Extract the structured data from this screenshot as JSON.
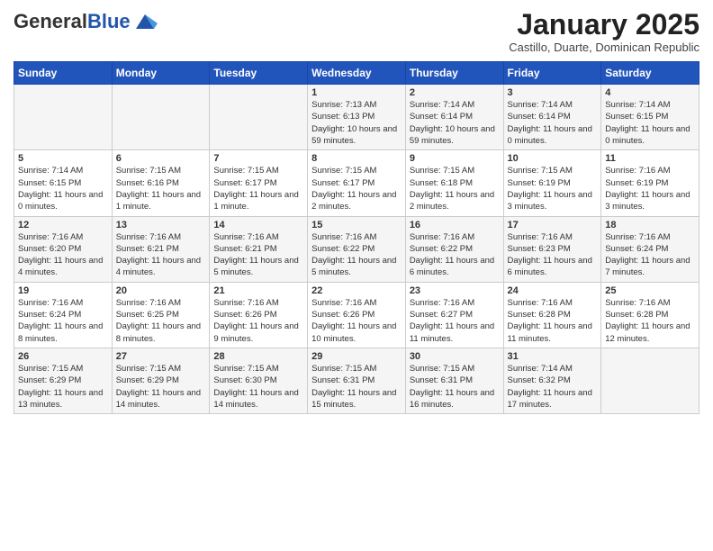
{
  "header": {
    "logo_general": "General",
    "logo_blue": "Blue",
    "month_title": "January 2025",
    "subtitle": "Castillo, Duarte, Dominican Republic"
  },
  "days_of_week": [
    "Sunday",
    "Monday",
    "Tuesday",
    "Wednesday",
    "Thursday",
    "Friday",
    "Saturday"
  ],
  "weeks": [
    [
      {
        "day": "",
        "info": ""
      },
      {
        "day": "",
        "info": ""
      },
      {
        "day": "",
        "info": ""
      },
      {
        "day": "1",
        "info": "Sunrise: 7:13 AM\nSunset: 6:13 PM\nDaylight: 10 hours and 59 minutes."
      },
      {
        "day": "2",
        "info": "Sunrise: 7:14 AM\nSunset: 6:14 PM\nDaylight: 10 hours and 59 minutes."
      },
      {
        "day": "3",
        "info": "Sunrise: 7:14 AM\nSunset: 6:14 PM\nDaylight: 11 hours and 0 minutes."
      },
      {
        "day": "4",
        "info": "Sunrise: 7:14 AM\nSunset: 6:15 PM\nDaylight: 11 hours and 0 minutes."
      }
    ],
    [
      {
        "day": "5",
        "info": "Sunrise: 7:14 AM\nSunset: 6:15 PM\nDaylight: 11 hours and 0 minutes."
      },
      {
        "day": "6",
        "info": "Sunrise: 7:15 AM\nSunset: 6:16 PM\nDaylight: 11 hours and 1 minute."
      },
      {
        "day": "7",
        "info": "Sunrise: 7:15 AM\nSunset: 6:17 PM\nDaylight: 11 hours and 1 minute."
      },
      {
        "day": "8",
        "info": "Sunrise: 7:15 AM\nSunset: 6:17 PM\nDaylight: 11 hours and 2 minutes."
      },
      {
        "day": "9",
        "info": "Sunrise: 7:15 AM\nSunset: 6:18 PM\nDaylight: 11 hours and 2 minutes."
      },
      {
        "day": "10",
        "info": "Sunrise: 7:15 AM\nSunset: 6:19 PM\nDaylight: 11 hours and 3 minutes."
      },
      {
        "day": "11",
        "info": "Sunrise: 7:16 AM\nSunset: 6:19 PM\nDaylight: 11 hours and 3 minutes."
      }
    ],
    [
      {
        "day": "12",
        "info": "Sunrise: 7:16 AM\nSunset: 6:20 PM\nDaylight: 11 hours and 4 minutes."
      },
      {
        "day": "13",
        "info": "Sunrise: 7:16 AM\nSunset: 6:21 PM\nDaylight: 11 hours and 4 minutes."
      },
      {
        "day": "14",
        "info": "Sunrise: 7:16 AM\nSunset: 6:21 PM\nDaylight: 11 hours and 5 minutes."
      },
      {
        "day": "15",
        "info": "Sunrise: 7:16 AM\nSunset: 6:22 PM\nDaylight: 11 hours and 5 minutes."
      },
      {
        "day": "16",
        "info": "Sunrise: 7:16 AM\nSunset: 6:22 PM\nDaylight: 11 hours and 6 minutes."
      },
      {
        "day": "17",
        "info": "Sunrise: 7:16 AM\nSunset: 6:23 PM\nDaylight: 11 hours and 6 minutes."
      },
      {
        "day": "18",
        "info": "Sunrise: 7:16 AM\nSunset: 6:24 PM\nDaylight: 11 hours and 7 minutes."
      }
    ],
    [
      {
        "day": "19",
        "info": "Sunrise: 7:16 AM\nSunset: 6:24 PM\nDaylight: 11 hours and 8 minutes."
      },
      {
        "day": "20",
        "info": "Sunrise: 7:16 AM\nSunset: 6:25 PM\nDaylight: 11 hours and 8 minutes."
      },
      {
        "day": "21",
        "info": "Sunrise: 7:16 AM\nSunset: 6:26 PM\nDaylight: 11 hours and 9 minutes."
      },
      {
        "day": "22",
        "info": "Sunrise: 7:16 AM\nSunset: 6:26 PM\nDaylight: 11 hours and 10 minutes."
      },
      {
        "day": "23",
        "info": "Sunrise: 7:16 AM\nSunset: 6:27 PM\nDaylight: 11 hours and 11 minutes."
      },
      {
        "day": "24",
        "info": "Sunrise: 7:16 AM\nSunset: 6:28 PM\nDaylight: 11 hours and 11 minutes."
      },
      {
        "day": "25",
        "info": "Sunrise: 7:16 AM\nSunset: 6:28 PM\nDaylight: 11 hours and 12 minutes."
      }
    ],
    [
      {
        "day": "26",
        "info": "Sunrise: 7:15 AM\nSunset: 6:29 PM\nDaylight: 11 hours and 13 minutes."
      },
      {
        "day": "27",
        "info": "Sunrise: 7:15 AM\nSunset: 6:29 PM\nDaylight: 11 hours and 14 minutes."
      },
      {
        "day": "28",
        "info": "Sunrise: 7:15 AM\nSunset: 6:30 PM\nDaylight: 11 hours and 14 minutes."
      },
      {
        "day": "29",
        "info": "Sunrise: 7:15 AM\nSunset: 6:31 PM\nDaylight: 11 hours and 15 minutes."
      },
      {
        "day": "30",
        "info": "Sunrise: 7:15 AM\nSunset: 6:31 PM\nDaylight: 11 hours and 16 minutes."
      },
      {
        "day": "31",
        "info": "Sunrise: 7:14 AM\nSunset: 6:32 PM\nDaylight: 11 hours and 17 minutes."
      },
      {
        "day": "",
        "info": ""
      }
    ]
  ]
}
